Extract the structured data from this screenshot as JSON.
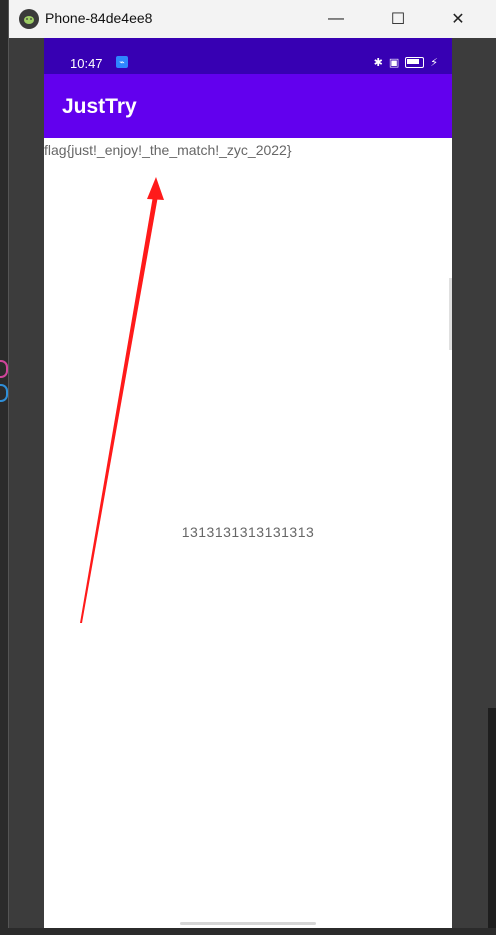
{
  "window": {
    "title": "Phone-84de4ee8",
    "minimize": "—",
    "maximize": "☐",
    "close": "✕",
    "icon": "android-icon"
  },
  "statusbar": {
    "time": "10:47",
    "usb_icon": "usb-debug-icon",
    "icons": [
      "bluetooth-icon",
      "screen-record-icon",
      "battery-icon",
      "charging-icon"
    ]
  },
  "app": {
    "title": "JustTry",
    "flag_text": "flag{just!_enjoy!_the_match!_zyc_2022}",
    "center_text": "1313131313131313"
  },
  "colors": {
    "statusbar": "#3700b3",
    "appbar": "#6200ee",
    "arrow": "#ff1a1a"
  },
  "annotation": {
    "type": "arrow",
    "color": "#ff1a1a"
  }
}
